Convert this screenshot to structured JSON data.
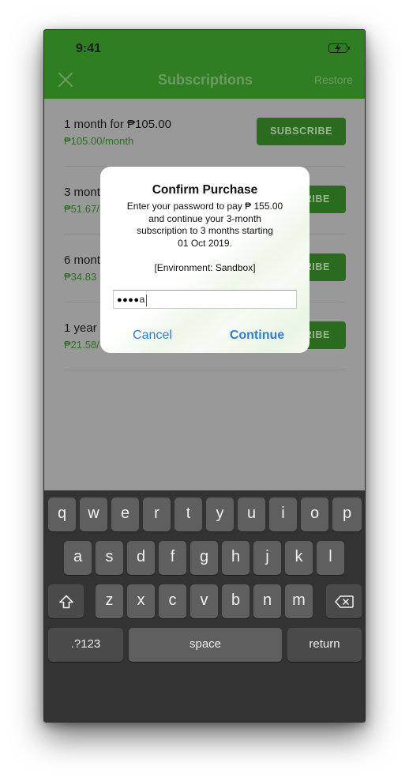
{
  "status_bar": {
    "time": "9:41",
    "battery_icon": "battery-charging-icon"
  },
  "nav": {
    "title": "Subscriptions",
    "restore_label": "Restore",
    "close_icon": "close-icon",
    "background_color": "#2f7e22"
  },
  "subscriptions": [
    {
      "title": "1 month for ₱105.00",
      "price": "₱105.00/month",
      "button_label": "SUBSCRIBE"
    },
    {
      "title": "3 mont",
      "price": "₱51.67/",
      "button_label": "RIBE"
    },
    {
      "title": "6 mont",
      "price": "₱34.83",
      "button_label": "RIBE"
    },
    {
      "title": "1 year",
      "price": "₱21.58/",
      "button_label": "RIBE"
    }
  ],
  "alert": {
    "title": "Confirm Purchase",
    "message_lines": [
      "Enter your password to pay ₱ 155.00",
      "and continue your 3-month",
      "subscription to 3 months starting",
      "01 Oct 2019."
    ],
    "environment": "[Environment: Sandbox]",
    "password_masked": "●●●●",
    "password_last_char": "a",
    "cancel_label": "Cancel",
    "continue_label": "Continue",
    "button_color": "#2f7ed6"
  },
  "keyboard": {
    "row1": [
      "q",
      "w",
      "e",
      "r",
      "t",
      "y",
      "u",
      "i",
      "o",
      "p"
    ],
    "row2": [
      "a",
      "s",
      "d",
      "f",
      "g",
      "h",
      "j",
      "k",
      "l"
    ],
    "row3": [
      "z",
      "x",
      "c",
      "v",
      "b",
      "n",
      "m"
    ],
    "shift_icon": "shift-icon",
    "delete_icon": "backspace-icon",
    "numbers_label": ".?123",
    "space_label": "space",
    "return_label": "return"
  }
}
